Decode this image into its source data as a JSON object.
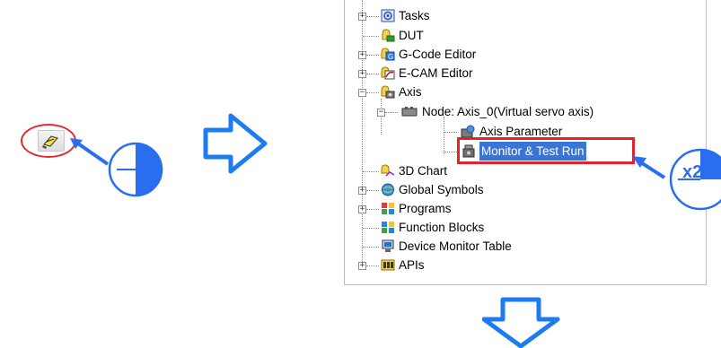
{
  "tree": {
    "items": [
      {
        "label": "Tasks",
        "icon": "tasks-icon"
      },
      {
        "label": "DUT",
        "icon": "dut-icon"
      },
      {
        "label": "G-Code Editor",
        "icon": "gcode-editor-icon"
      },
      {
        "label": "E-CAM Editor",
        "icon": "ecam-editor-icon"
      },
      {
        "label": "Axis",
        "icon": "axis-icon"
      },
      {
        "label": "Node: Axis_0(Virtual servo axis)",
        "icon": "node-icon"
      },
      {
        "label": "Axis Parameter",
        "icon": "axis-parameter-icon"
      },
      {
        "label": "Monitor & Test Run",
        "icon": "monitor-test-run-icon",
        "selected": true
      },
      {
        "label": "3D Chart",
        "icon": "3d-chart-icon"
      },
      {
        "label": "Global Symbols",
        "icon": "global-symbols-icon"
      },
      {
        "label": "Programs",
        "icon": "programs-icon"
      },
      {
        "label": "Function Blocks",
        "icon": "function-blocks-icon"
      },
      {
        "label": "Device Monitor Table",
        "icon": "device-monitor-table-icon"
      },
      {
        "label": "APIs",
        "icon": "apis-icon"
      }
    ]
  },
  "annotation": {
    "double_click_label": "x2",
    "highlight_color": "#e0242b",
    "arrow_color": "#2a6ef0"
  }
}
